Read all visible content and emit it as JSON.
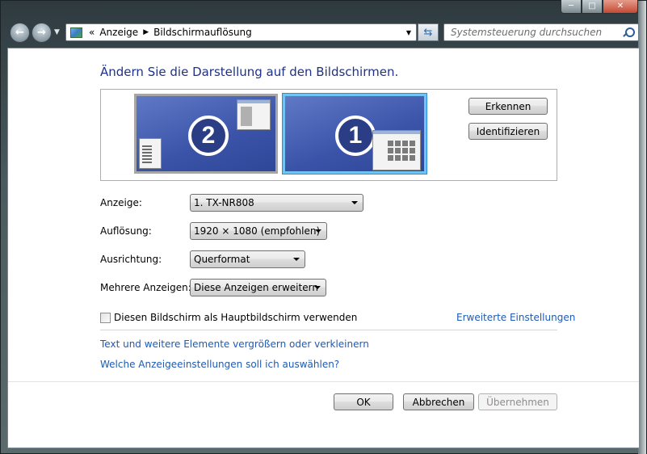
{
  "window": {
    "caption_buttons": [
      "minimize-icon",
      "maximize-icon",
      "close-icon"
    ]
  },
  "nav": {
    "back_icon": "back-arrow-icon",
    "forward_icon": "forward-arrow-icon",
    "breadcrumb_prefix": "«",
    "breadcrumb": [
      "Anzeige",
      "Bildschirmauflösung"
    ],
    "search_placeholder": "Systemsteuerung durchsuchen"
  },
  "main": {
    "heading": "Ändern Sie die Darstellung auf den Bildschirmen.",
    "monitors": [
      {
        "number": "2",
        "selected": false
      },
      {
        "number": "1",
        "selected": true
      }
    ],
    "detect_button": "Erkennen",
    "identify_button": "Identifizieren",
    "fields": {
      "display_label": "Anzeige:",
      "display_value": "1. TX-NR808",
      "resolution_label": "Auflösung:",
      "resolution_value": "1920 × 1080 (empfohlen)",
      "orientation_label": "Ausrichtung:",
      "orientation_value": "Querformat",
      "multiple_label": "Mehrere Anzeigen:",
      "multiple_value": "Diese Anzeigen erweitern"
    },
    "primary_checkbox_label": "Diesen Bildschirm als Hauptbildschirm verwenden",
    "primary_checked": false,
    "advanced_link": "Erweiterte Einstellungen",
    "link_text_size": "Text und weitere Elemente vergrößern oder verkleinern",
    "link_which_settings": "Welche Anzeigeeinstellungen soll ich auswählen?"
  },
  "footer": {
    "ok": "OK",
    "cancel": "Abbrechen",
    "apply": "Übernehmen"
  },
  "colors": {
    "heading": "#1e3287",
    "link": "#1e5ab4",
    "selected_monitor_border": "#70c4f4"
  }
}
